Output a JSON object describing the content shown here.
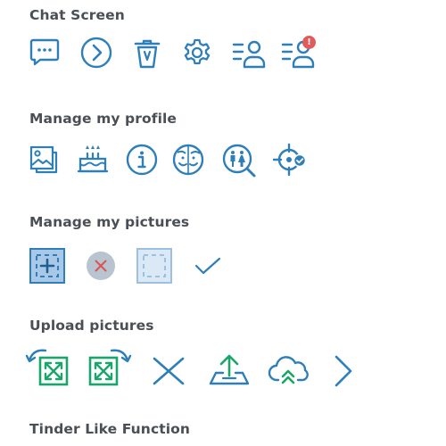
{
  "sections": [
    {
      "title": "Chat Screen",
      "icons": [
        "chat-bubble-icon",
        "arrow-right-circle-icon",
        "trash-icon",
        "gear-icon",
        "user-list-icon",
        "user-list-alert-icon"
      ],
      "alert_badge": "!"
    },
    {
      "title": "Manage my profile",
      "icons": [
        "picture-icon",
        "birthday-cake-icon",
        "info-icon",
        "couple-faces-icon",
        "search-gender-icon",
        "location-target-icon"
      ]
    },
    {
      "title": "Manage my pictures",
      "icons": [
        "add-photo-icon",
        "remove-circle-icon",
        "empty-photo-slot-icon",
        "checkmark-icon"
      ]
    },
    {
      "title": "Upload pictures",
      "icons": [
        "rotate-left-icon",
        "rotate-right-icon",
        "close-x-icon",
        "upload-tray-icon",
        "cloud-upload-icon",
        "chevron-right-icon"
      ]
    },
    {
      "title": "Tinder Like Function"
    }
  ],
  "colors": {
    "icon_blue": "#2e7fb8",
    "icon_green": "#1aa56a",
    "alert_red": "#e25b5b",
    "title_gray": "#4a4f55",
    "slot_fill": "#d4e4f3",
    "remove_circle": "#b8c5d1",
    "remove_x": "#d9534f"
  }
}
